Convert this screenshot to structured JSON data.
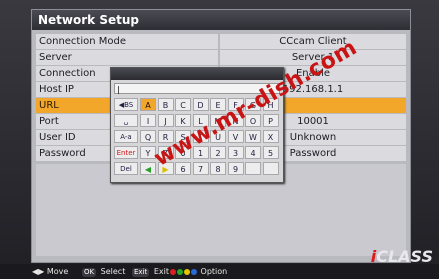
{
  "title": "Network Setup",
  "rows": [
    {
      "label": "Connection Mode",
      "value": "CCcam Client"
    },
    {
      "label": "Server",
      "value": "Server 1"
    },
    {
      "label": "Connection",
      "value": "Enable"
    },
    {
      "label": "Host IP",
      "value": "192.168.1.1"
    },
    {
      "label": "URL",
      "value": ""
    },
    {
      "label": "Port",
      "value": "10001"
    },
    {
      "label": "User ID",
      "value": "Unknown"
    },
    {
      "label": "Password",
      "value": "Password"
    }
  ],
  "keyboard": {
    "input": "|",
    "rows": [
      {
        "func": "◀BS",
        "keys": [
          "A",
          "B",
          "C",
          "D",
          "E",
          "F",
          "G",
          "H"
        ]
      },
      {
        "func": "␣",
        "keys": [
          "I",
          "J",
          "K",
          "L",
          "M",
          "N",
          "O",
          "P"
        ]
      },
      {
        "func": "A-a",
        "keys": [
          "Q",
          "R",
          "S",
          "T",
          "U",
          "V",
          "W",
          "X"
        ]
      },
      {
        "func": "Enter",
        "keys": [
          "Y",
          "Z",
          "0",
          "1",
          "2",
          "3",
          "4",
          "5"
        ]
      },
      {
        "func": "Del",
        "keys": [
          "◀",
          "▶",
          "6",
          "7",
          "8",
          "9",
          "",
          ""
        ]
      }
    ],
    "selected_key": "A"
  },
  "footer": {
    "move": "Move",
    "ok_btn": "OK",
    "select": "Select",
    "exit_btn": "Exit",
    "exit": "Exit",
    "option": "Option"
  },
  "watermark": "www.mr-dish.com",
  "logo": {
    "prefix": "i",
    "text": "CLASS"
  },
  "colors": {
    "highlight": "#f2a62a",
    "panel": "#b9b9c0",
    "watermark": "#c81414"
  }
}
